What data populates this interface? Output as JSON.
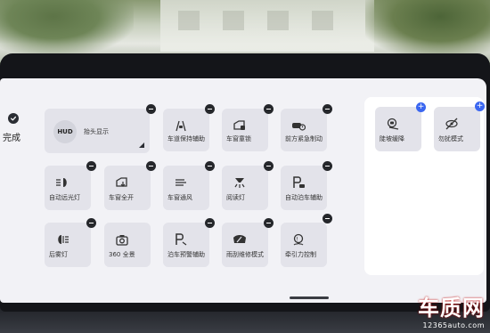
{
  "toolbar": {
    "done_label": "完成"
  },
  "hud": {
    "badge": "HUD",
    "title": "抬头显示"
  },
  "tiles": [
    {
      "label": "车道保持辅助",
      "icon": "lane-keep-icon"
    },
    {
      "label": "车窗童锁",
      "icon": "window-lock-icon"
    },
    {
      "label": "前方紧急制动",
      "icon": "emergency-brake-icon"
    },
    {
      "label": "自动远光灯",
      "icon": "auto-highbeam-icon"
    },
    {
      "label": "车窗全开",
      "icon": "window-open-icon"
    },
    {
      "label": "车窗通风",
      "icon": "window-vent-icon"
    },
    {
      "label": "阅读灯",
      "icon": "reading-light-icon"
    },
    {
      "label": "自动泊车辅助",
      "icon": "auto-park-icon"
    },
    {
      "label": "后雾灯",
      "icon": "rear-fog-icon"
    },
    {
      "label": "360 全景",
      "icon": "camera-icon"
    },
    {
      "label": "泊车预警辅助",
      "icon": "park-warning-icon"
    },
    {
      "label": "雨刮维修模式",
      "icon": "wiper-icon"
    },
    {
      "label": "牵引力控制",
      "icon": "traction-control-icon"
    }
  ],
  "available": [
    {
      "label": "陡坡缓降",
      "icon": "hill-descent-icon"
    },
    {
      "label": "勿扰模式",
      "icon": "do-not-disturb-icon"
    }
  ],
  "watermark": {
    "brand": "车质网",
    "url": "12365auto.com"
  }
}
